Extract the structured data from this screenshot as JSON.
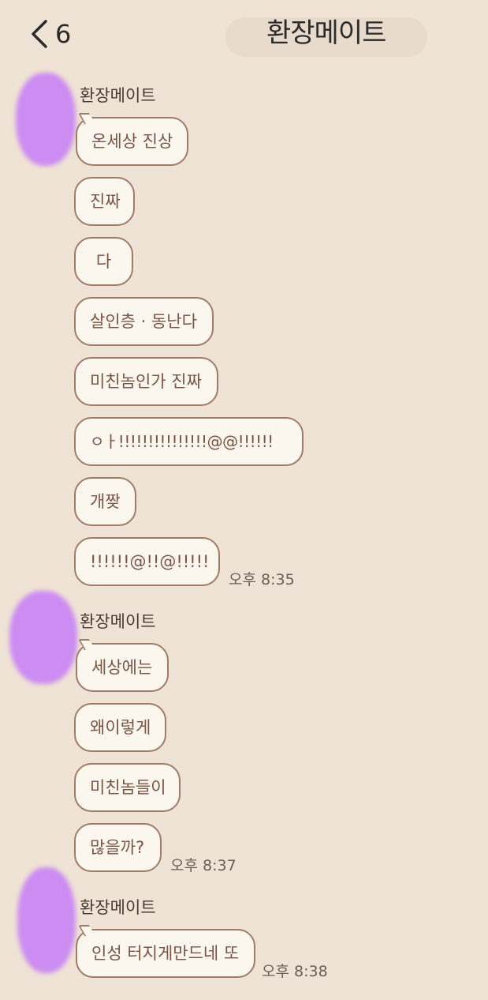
{
  "header": {
    "unread_count": "6",
    "title": "환장메이트"
  },
  "groups": [
    {
      "sender": "환장메이트",
      "messages": [
        "온세상 진상",
        "진짜",
        "다",
        "살인층 · 동난다",
        "미친놈인가 진짜",
        "ㅇㅏ!!!!!!!!!!!!!!!@@!!!!!!",
        "개짲",
        "!!!!!!@!!@!!!!!"
      ],
      "time": "오후 8:35"
    },
    {
      "sender": "환장메이트",
      "messages": [
        "세상에는",
        "왜이렇게",
        "미친놈들이",
        "많을까?"
      ],
      "time": "오후 8:37"
    },
    {
      "sender": "환장메이트",
      "messages": [
        "인성 터지게만드네 또"
      ],
      "time": "오후 8:38"
    }
  ]
}
